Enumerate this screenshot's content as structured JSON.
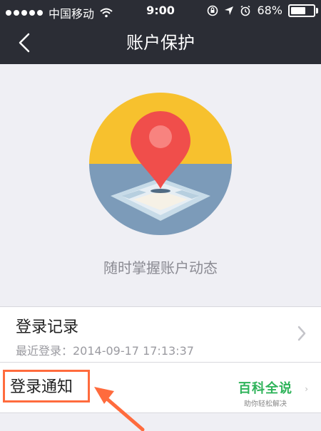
{
  "status_bar": {
    "carrier": "中国移动",
    "time": "9:00",
    "battery": "68%",
    "battery_level": 0.68
  },
  "nav": {
    "title": "账户保护"
  },
  "caption": "随时掌握账户动态",
  "list": {
    "login_record": {
      "title": "登录记录",
      "subtitle": "最近登录：2014-09-17 17:13:37"
    },
    "login_notify": {
      "title": "登录通知"
    }
  },
  "watermark": {
    "title": "百科全说",
    "subtitle": "助你轻松解决"
  },
  "colors": {
    "nav_bg": "#2b2d35",
    "accent_orange": "#ff6b3d",
    "pin_red": "#f04e4b",
    "sun_yellow": "#f7c12e",
    "sea_blue": "#7c9bb9",
    "watermark_green": "#2fb35a"
  }
}
